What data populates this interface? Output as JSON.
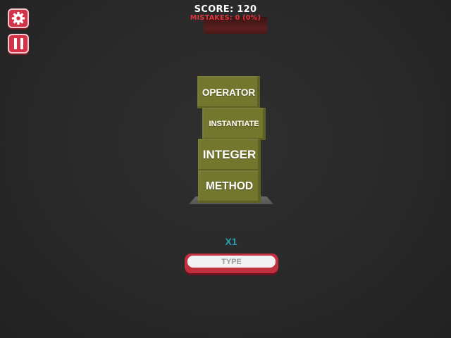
{
  "hud": {
    "score_text": "SCORE: 120",
    "mistakes_text": "MISTAKES: 0 (0%)"
  },
  "controls": {
    "settings_icon": "gear-icon",
    "pause_icon": "pause-icon"
  },
  "tower": {
    "blocks": [
      "OPERATOR",
      "INSTANTIATE",
      "INTEGER",
      "METHOD"
    ]
  },
  "multiplier_text": "X1",
  "input": {
    "placeholder": "TYPE"
  },
  "colors": {
    "background": "#2a2a2a",
    "button_red": "#d33348",
    "mistakes_red": "#e0353f",
    "block_olive": "#73772d",
    "multiplier_teal": "#2a9fb0"
  }
}
